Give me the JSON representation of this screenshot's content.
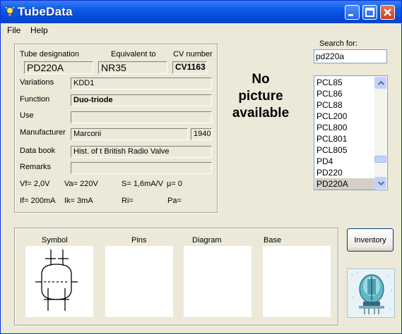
{
  "window": {
    "title": "TubeData"
  },
  "menu": {
    "file": "File",
    "help": "Help"
  },
  "tube": {
    "designation_label": "Tube designation",
    "designation": "PD220A",
    "equivalent_label": "Equivalent to",
    "equivalent": "NR35",
    "cv_label": "CV number",
    "cv": "CV1163",
    "variations_label": "Variations",
    "variations": "KDD1",
    "function_label": "Function",
    "function": "Duo-triode",
    "use_label": "Use",
    "use": "",
    "manufacturer_label": "Manufacturer",
    "manufacturer": "Marconi",
    "year": "1940",
    "databook_label": "Data book",
    "databook": "Hist. of t British Radio Valve",
    "remarks_label": "Remarks",
    "remarks": "",
    "vf": "Vf= 2,0V",
    "va": "Va= 220V",
    "s": "S= 1,6mA/V",
    "mu": "µ=   0",
    "if": "If= 200mA",
    "ik": "Ik=  3mA",
    "ri": "Ri=",
    "pa": "Pa="
  },
  "picture": {
    "line1": "No",
    "line2": "picture",
    "line3": "available"
  },
  "search": {
    "label": "Search for:",
    "value": "pd220a"
  },
  "list": {
    "items": [
      "PCL85",
      "PCL86",
      "PCL88",
      "PCL200",
      "PCL800",
      "PCL801",
      "PCL805",
      "PD4",
      "PD220",
      "PD220A"
    ],
    "selected_index": 9
  },
  "panels": {
    "symbol": "Symbol",
    "pins": "Pins",
    "diagram": "Diagram",
    "base": "Base"
  },
  "inventory_button": "Inventory"
}
